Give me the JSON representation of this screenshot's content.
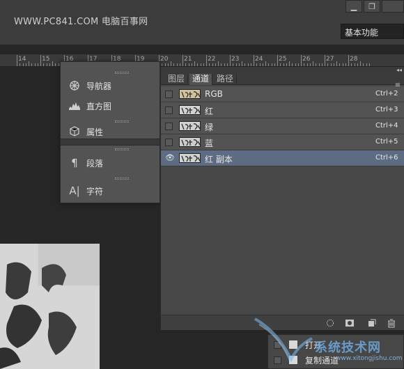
{
  "header": {
    "watermark": "WWW.PC841.COM 电脑百事网",
    "workspace": "基本功能",
    "minimize_icon": "minimize-icon",
    "restore_icon": "restore-icon"
  },
  "ruler": {
    "numbers": [
      "14",
      "15",
      "16",
      "17",
      "18",
      "19",
      "20",
      "21",
      "22",
      "23",
      "24",
      "25",
      "26",
      "27",
      "28"
    ]
  },
  "left_panel": {
    "items": [
      {
        "label": "导航器",
        "icon": "navigator-icon"
      },
      {
        "label": "直方图",
        "icon": "histogram-icon"
      },
      {
        "label": "属性",
        "icon": "properties-icon"
      },
      {
        "label": "段落",
        "icon": "paragraph-icon"
      },
      {
        "label": "字符",
        "icon": "character-icon"
      }
    ]
  },
  "channels_panel": {
    "tabs": [
      {
        "label": "图层",
        "active": false
      },
      {
        "label": "通道",
        "active": true
      },
      {
        "label": "路径",
        "active": false
      }
    ],
    "rows": [
      {
        "name": "RGB",
        "shortcut": "Ctrl+2",
        "visible": false,
        "selected": false
      },
      {
        "name": "红",
        "shortcut": "Ctrl+3",
        "visible": false,
        "selected": false
      },
      {
        "name": "绿",
        "shortcut": "Ctrl+4",
        "visible": false,
        "selected": false
      },
      {
        "name": "蓝",
        "shortcut": "Ctrl+5",
        "visible": false,
        "selected": false
      },
      {
        "name": "红 副本",
        "shortcut": "Ctrl+6",
        "visible": true,
        "selected": true
      }
    ],
    "footer_icons": [
      "load-selection-icon",
      "save-selection-icon",
      "new-channel-icon",
      "delete-channel-icon"
    ]
  },
  "actions_panel": {
    "items": [
      {
        "label": "打开"
      },
      {
        "label": "复制通道"
      }
    ]
  },
  "site_watermark": {
    "title": "系统技术网",
    "url": "www.xitongjishu.com"
  },
  "colors": {
    "selected_row": "#5d6c82",
    "panel_bg": "#535353",
    "app_bg": "#262626"
  }
}
